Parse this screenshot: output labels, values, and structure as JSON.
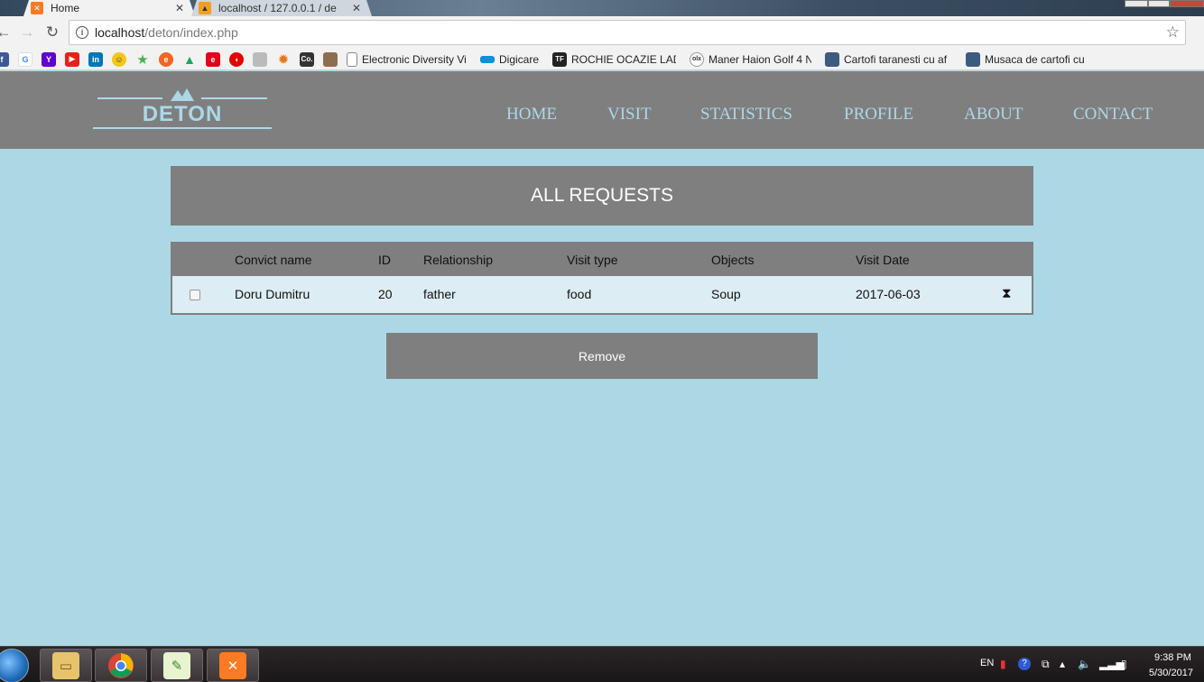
{
  "browser": {
    "tabs": [
      {
        "title": "Home",
        "favicon": "xampp-icon",
        "active": true
      },
      {
        "title": "localhost / 127.0.0.1 / de",
        "favicon": "phpmyadmin-icon",
        "active": false
      }
    ],
    "close_glyph": "✕",
    "url_host": "localhost",
    "url_path": "/deton/index.php",
    "bookmarks": [
      {
        "label": "Electronic Diversity Vi",
        "icon": "page-icon"
      },
      {
        "label": "Digicare",
        "icon": "digicare-icon"
      },
      {
        "label": "ROCHIE OCAZIE LADY",
        "icon": "tf-icon"
      },
      {
        "label": "Maner Haion Golf 4 N",
        "icon": "olx-icon"
      },
      {
        "label": "Cartofi taranesti cu af",
        "icon": "recipe-icon"
      },
      {
        "label": "Musaca de cartofi cu c",
        "icon": "recipe-icon"
      }
    ]
  },
  "site": {
    "logo_text": "DETON",
    "nav": [
      "HOME",
      "VISIT",
      "STATISTICS",
      "PROFILE",
      "ABOUT",
      "CONTACT"
    ]
  },
  "banner_title": "ALL REQUESTS",
  "table": {
    "headers": [
      "Convict name",
      "ID",
      "Relationship",
      "Visit type",
      "Objects",
      "Visit Date"
    ],
    "rows": [
      {
        "name": "Doru Dumitru",
        "id": "20",
        "relationship": "father",
        "visit_type": "food",
        "objects": "Soup",
        "date": "2017-06-03",
        "status_icon": "hourglass-icon"
      }
    ]
  },
  "remove_label": "Remove",
  "taskbar": {
    "apps": [
      "file-explorer-icon",
      "chrome-icon",
      "notepad-plus-plus-icon",
      "xampp-icon"
    ],
    "language": "EN",
    "time": "9:38 PM",
    "date": "5/30/2017"
  }
}
